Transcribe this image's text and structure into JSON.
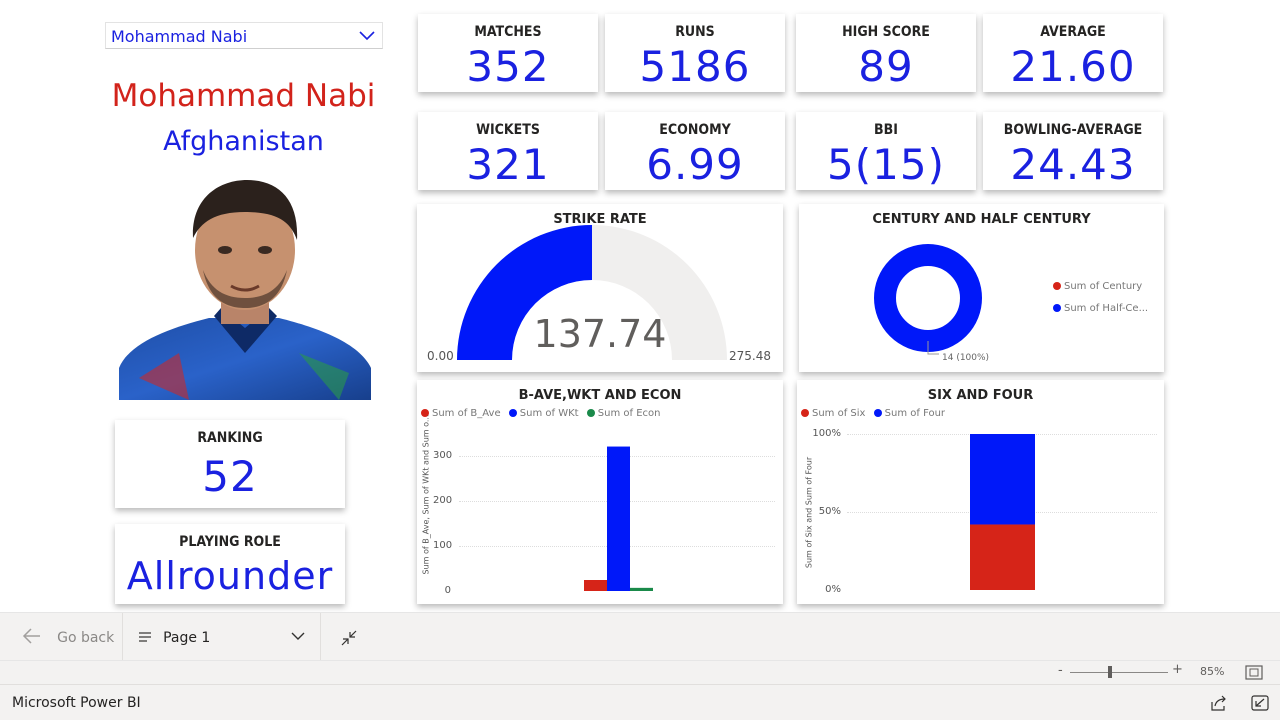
{
  "slicer": {
    "selected": "Mohammad Nabi"
  },
  "player": {
    "name": "Mohammad Nabi",
    "country": "Afghanistan"
  },
  "kpis": [
    {
      "label": "MATCHES",
      "value": "352"
    },
    {
      "label": "RUNS",
      "value": "5186"
    },
    {
      "label": "HIGH SCORE",
      "value": "89"
    },
    {
      "label": "AVERAGE",
      "value": "21.60"
    },
    {
      "label": "WICKETS",
      "value": "321"
    },
    {
      "label": "ECONOMY",
      "value": "6.99"
    },
    {
      "label": "BBI",
      "value": "5(15)"
    },
    {
      "label": "BOWLING-AVERAGE",
      "value": "24.43"
    }
  ],
  "ranking": {
    "label": "RANKING",
    "value": "52"
  },
  "role": {
    "label": "PLAYING ROLE",
    "value": "Allrounder"
  },
  "strike_rate": {
    "title": "STRIKE RATE",
    "value": 137.74,
    "value_label": "137.74",
    "min_label": "0.00",
    "max_label": "275.48",
    "min": 0,
    "max": 275.48
  },
  "century": {
    "title": "CENTURY AND HALF CENTURY",
    "legend": [
      "Sum of Century",
      "Sum of Half-Ce..."
    ],
    "data_label": "14 (100%)",
    "values": [
      0,
      14
    ]
  },
  "colors": {
    "blue": "#0018f9",
    "red": "#d62418",
    "green": "#1a8a4a",
    "gauge_bg": "#f0efee",
    "accent_text": "#1a21e0"
  },
  "bave": {
    "title": "B-AVE,WKT AND ECON",
    "legend": [
      "Sum of B_Ave",
      "Sum of WKt",
      "Sum of Econ"
    ],
    "ylabel": "Sum of B_Ave, Sum of WKt and Sum o...",
    "ticks": [
      "300",
      "200",
      "100",
      "0"
    ]
  },
  "sixfour": {
    "title": "SIX AND FOUR",
    "legend": [
      "Sum of Six",
      "Sum of Four"
    ],
    "ylabel": "Sum of Six and Sum of Four",
    "ticks": [
      "100%",
      "50%",
      "0%"
    ]
  },
  "chart_data": [
    {
      "type": "bar",
      "title": "B-AVE,WKT AND ECON",
      "ylabel": "Sum of B_Ave, Sum of WKt and Sum o...",
      "series": [
        {
          "name": "Sum of B_Ave",
          "values": [
            24.43
          ]
        },
        {
          "name": "Sum of WKt",
          "values": [
            321
          ]
        },
        {
          "name": "Sum of Econ",
          "values": [
            6.99
          ]
        }
      ],
      "ylim": [
        0,
        340
      ],
      "yticks": [
        0,
        100,
        200,
        300
      ],
      "legend": "top-left"
    },
    {
      "type": "bar",
      "stacked": "percent",
      "title": "SIX AND FOUR",
      "ylabel": "Sum of Six and Sum of Four",
      "series": [
        {
          "name": "Sum of Six",
          "values": [
            42
          ]
        },
        {
          "name": "Sum of Four",
          "values": [
            58
          ]
        }
      ],
      "ylim": [
        0,
        100
      ],
      "yticks": [
        "0%",
        "50%",
        "100%"
      ],
      "legend": "top-left"
    },
    {
      "type": "pie",
      "title": "CENTURY AND HALF CENTURY",
      "donut": true,
      "series": [
        {
          "name": "Sum of Century",
          "values": [
            0
          ]
        },
        {
          "name": "Sum of Half-Ce...",
          "values": [
            14
          ]
        }
      ],
      "legend": "right"
    }
  ],
  "nav": {
    "back_label": "Go back",
    "page_label": "Page 1"
  },
  "zoom": {
    "level": "85%"
  },
  "status": {
    "app_name": "Microsoft Power BI"
  }
}
